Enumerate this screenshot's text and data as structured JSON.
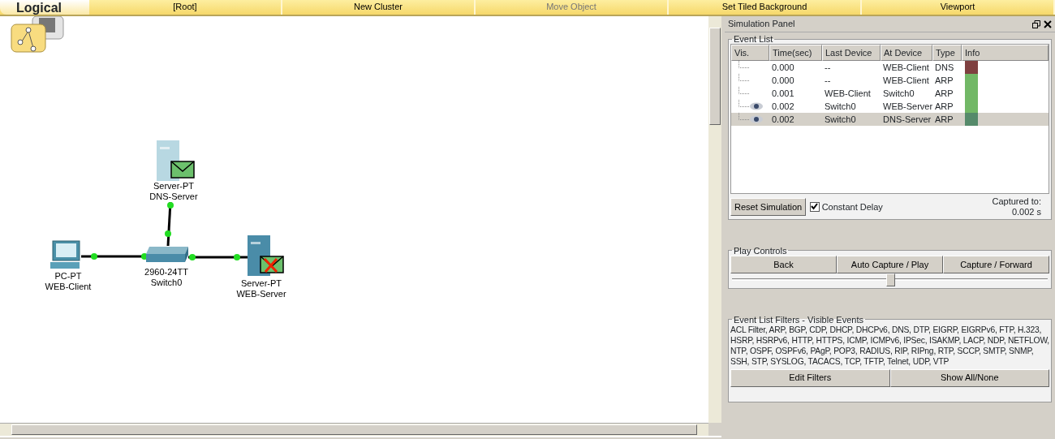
{
  "workspace_tab": {
    "label": "Logical",
    "selected": true
  },
  "toolbar": [
    {
      "label": "[Root]",
      "disabled": false
    },
    {
      "label": "New Cluster",
      "disabled": false
    },
    {
      "label": "Move Object",
      "disabled": true
    },
    {
      "label": "Set Tiled Background",
      "disabled": false
    },
    {
      "label": "Viewport",
      "disabled": false
    }
  ],
  "devices": [
    {
      "kind": "server",
      "model": "Server-PT",
      "name": "DNS-Server",
      "envelope": true,
      "dropped": false
    },
    {
      "kind": "pc",
      "model": "PC-PT",
      "name": "WEB-Client"
    },
    {
      "kind": "switch",
      "model": "2960-24TT",
      "name": "Switch0"
    },
    {
      "kind": "server",
      "model": "Server-PT",
      "name": "WEB-Server",
      "envelope": true,
      "dropped": true
    }
  ],
  "simulation_panel": {
    "title": "Simulation Panel",
    "event_list": {
      "title": "Event List",
      "columns": [
        "Vis.",
        "Time(sec)",
        "Last Device",
        "At Device",
        "Type",
        "Info"
      ],
      "rows": [
        {
          "visible": false,
          "time": "0.000",
          "last_device": "--",
          "at_device": "WEB-Client",
          "type": "DNS",
          "color": "#7f4040",
          "selected": false
        },
        {
          "visible": false,
          "time": "0.000",
          "last_device": "--",
          "at_device": "WEB-Client",
          "type": "ARP",
          "color": "#72b866",
          "selected": false
        },
        {
          "visible": false,
          "time": "0.001",
          "last_device": "WEB-Client",
          "at_device": "Switch0",
          "type": "ARP",
          "color": "#72b866",
          "selected": false
        },
        {
          "visible": true,
          "time": "0.002",
          "last_device": "Switch0",
          "at_device": "WEB-Server",
          "type": "ARP",
          "color": "#72b866",
          "selected": false
        },
        {
          "visible": true,
          "time": "0.002",
          "last_device": "Switch0",
          "at_device": "DNS-Server",
          "type": "ARP",
          "color": "#558a6a",
          "selected": true
        }
      ]
    },
    "reset_button": "Reset Simulation",
    "constant_delay": {
      "label": "Constant Delay",
      "checked": true
    },
    "captured_label": "Captured to:",
    "captured_value": "0.002 s",
    "play_controls": {
      "title": "Play Controls",
      "buttons": [
        "Back",
        "Auto Capture / Play",
        "Capture / Forward"
      ],
      "speed": {
        "level": 0.5
      }
    },
    "filters": {
      "title": "Event List Filters - Visible Events",
      "text": "ACL Filter, ARP, BGP, CDP, DHCP, DHCPv6, DNS, DTP, EIGRP, EIGRPv6, FTP, H.323, HSRP, HSRPv6, HTTP, HTTPS, ICMP, ICMPv6, IPSec, ISAKMP, LACP, NDP, NETFLOW, NTP, OSPF, OSPFv6, PAgP, POP3, RADIUS, RIP, RIPng, RTP, SCCP, SMTP, SNMP, SSH, STP, SYSLOG, TACACS, TCP, TFTP, Telnet, UDP, VTP",
      "buttons": [
        "Edit Filters",
        "Show All/None"
      ]
    }
  }
}
